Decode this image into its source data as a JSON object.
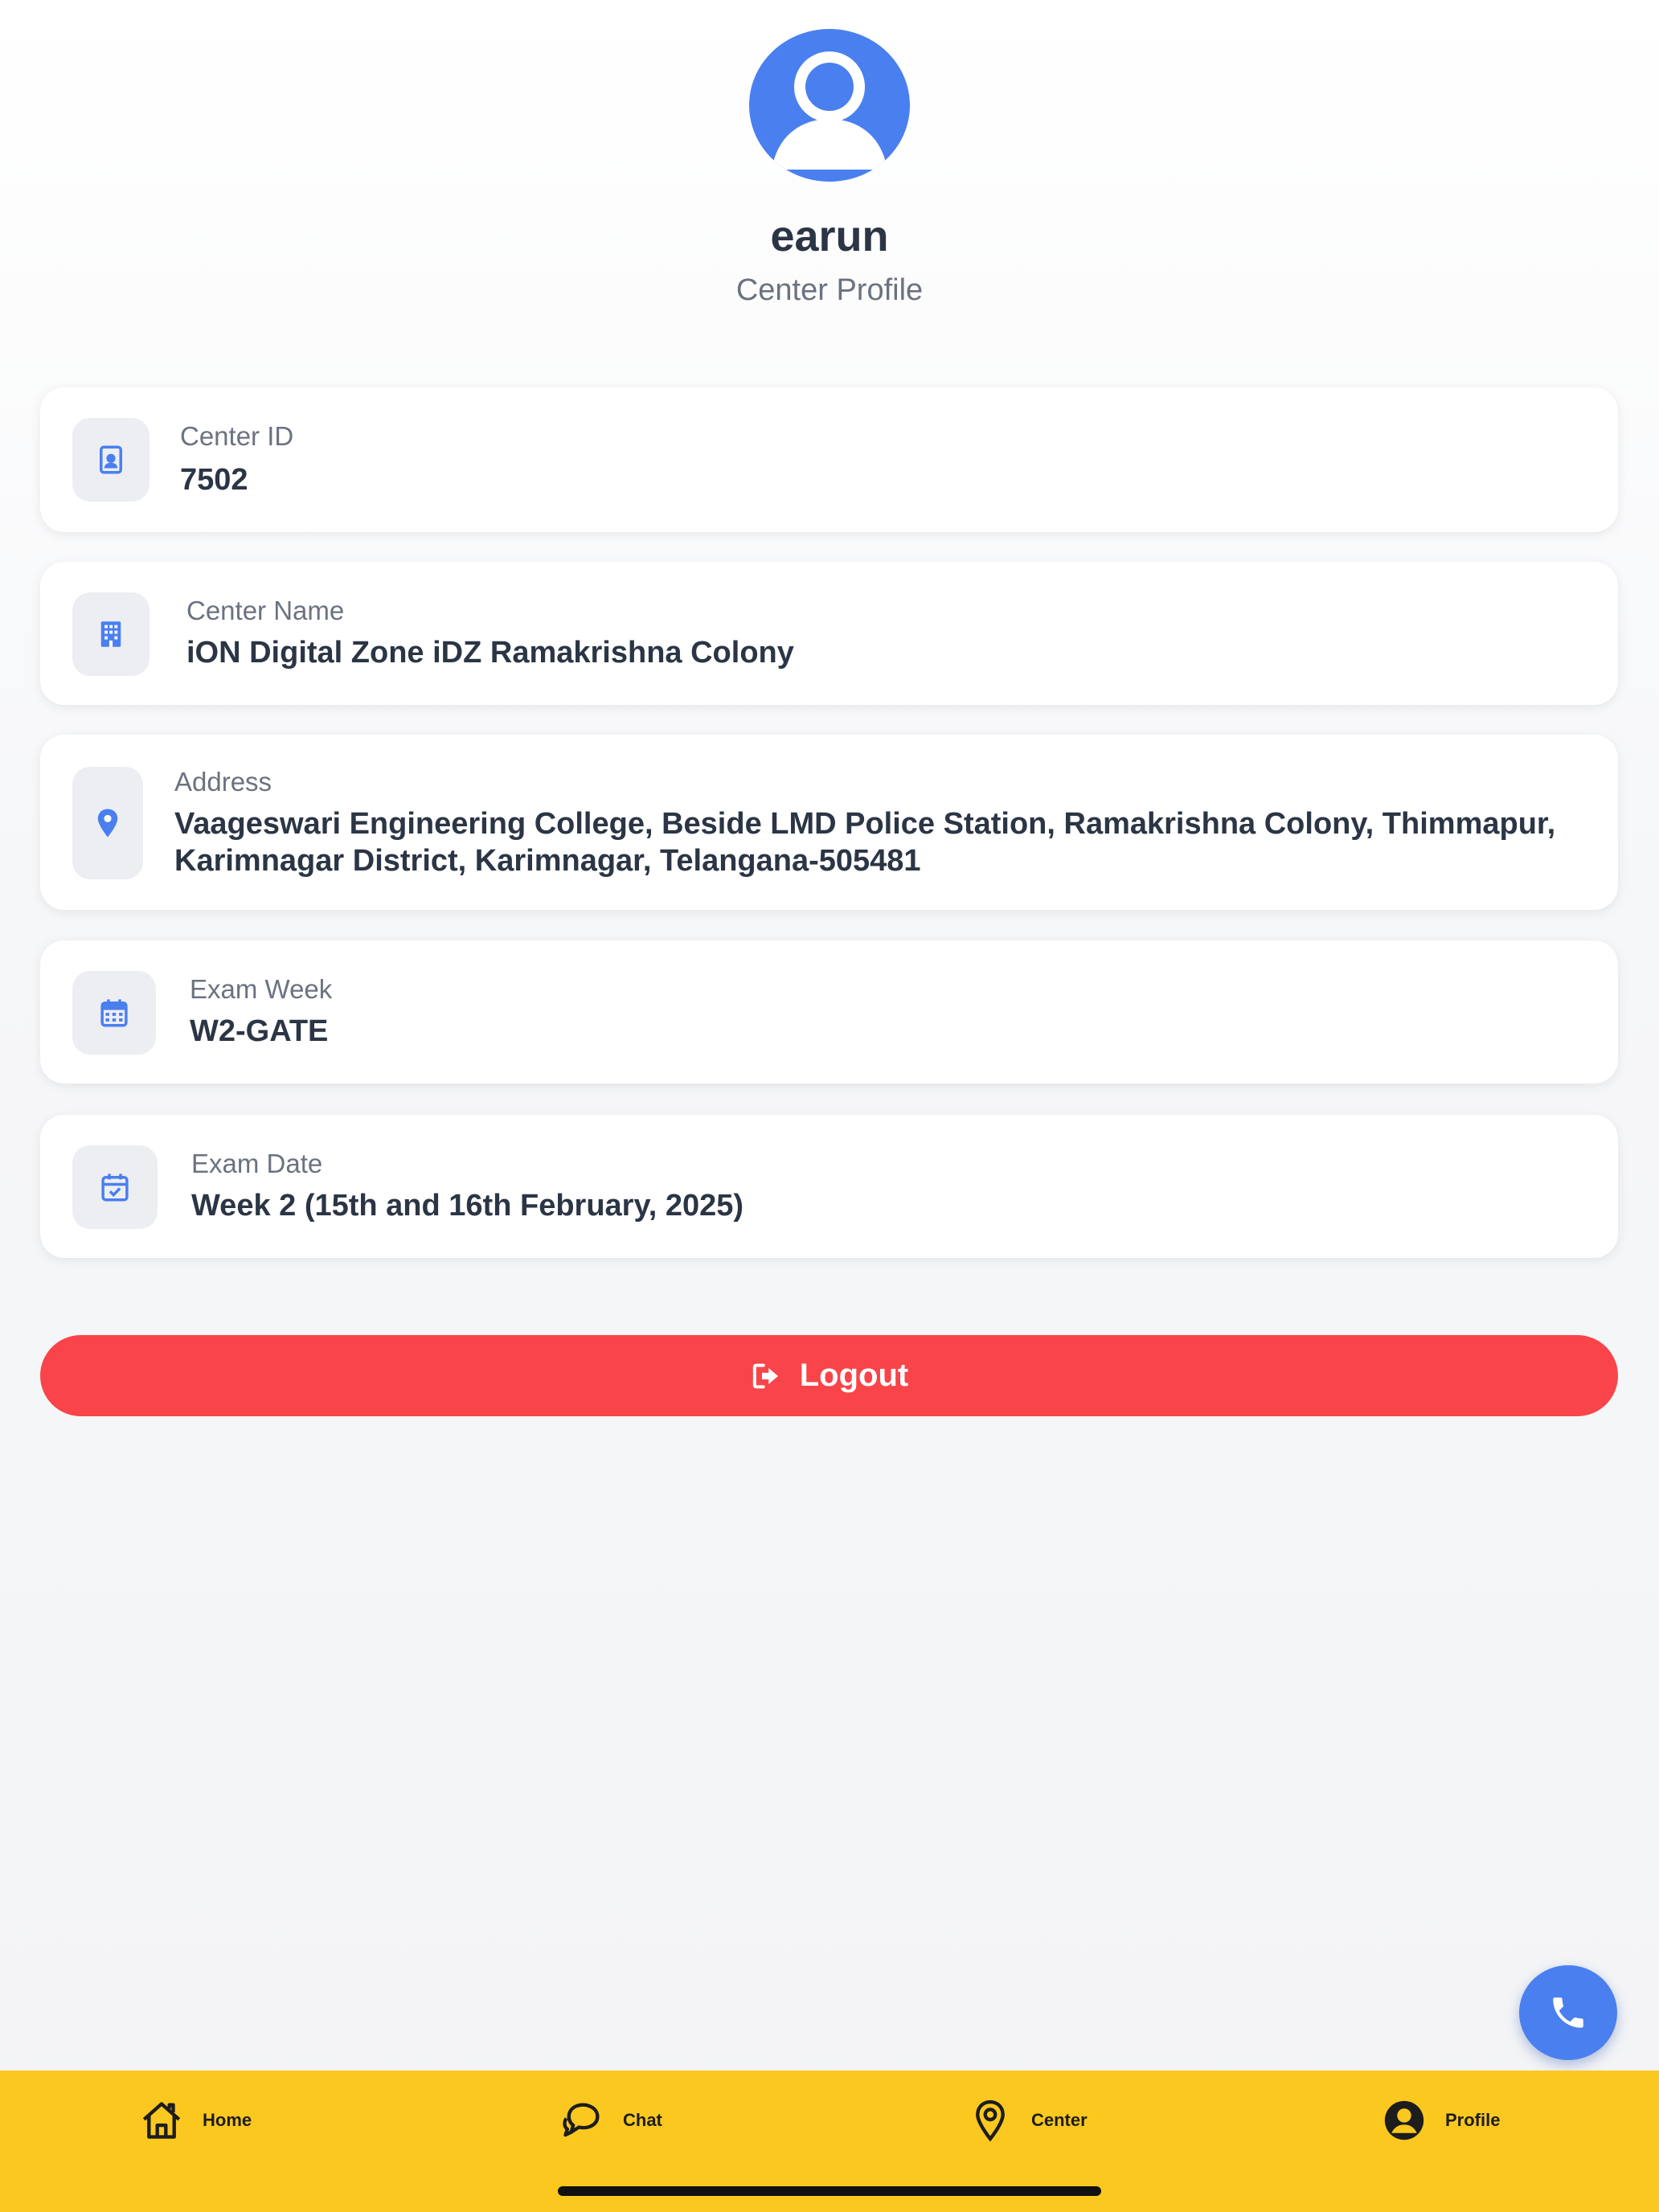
{
  "profile": {
    "username": "earun",
    "subtitle": "Center Profile",
    "avatar_icon": "user-avatar-icon"
  },
  "details": [
    {
      "label": "Center ID",
      "value": "7502",
      "icon": "id-badge-icon"
    },
    {
      "label": "Center Name",
      "value": "iON Digital Zone iDZ Ramakrishna Colony",
      "icon": "building-icon"
    },
    {
      "label": "Address",
      "value": "Vaageswari Engineering College, Beside LMD Police Station, Ramakrishna Colony, Thimmapur, Karimnagar District, Karimnagar, Telangana-505481",
      "icon": "location-pin-icon"
    },
    {
      "label": "Exam Week",
      "value": "W2-GATE",
      "icon": "calendar-icon"
    },
    {
      "label": "Exam Date",
      "value": "Week 2 (15th and 16th February, 2025)",
      "icon": "calendar-check-icon"
    }
  ],
  "logout": {
    "label": "Logout",
    "icon": "logout-icon"
  },
  "fab": {
    "icon": "phone-icon"
  },
  "tabs": [
    {
      "label": "Home",
      "icon": "home-icon"
    },
    {
      "label": "Chat",
      "icon": "chat-icon"
    },
    {
      "label": "Center",
      "icon": "location-pin-icon"
    },
    {
      "label": "Profile",
      "icon": "profile-icon"
    }
  ],
  "colors": {
    "accent": "#4a7ff0",
    "danger": "#f94449",
    "tabbar": "#fbc81f"
  }
}
